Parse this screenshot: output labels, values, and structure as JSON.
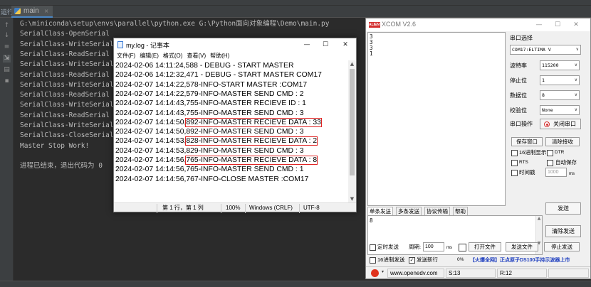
{
  "ide": {
    "run_label": "运行",
    "tab_label": "main",
    "tab_close": "×",
    "console_lines": [
      "G:\\miniconda\\setup\\envs\\parallel\\python.exe G:\\Python面向对象编程\\Demo\\main.py",
      "SerialClass-OpenSerial",
      "SerialClass-WriteSerial",
      "SerialClass-ReadSerial",
      "SerialClass-WriteSerial",
      "SerialClass-ReadSerial",
      "SerialClass-WriteSerial",
      "SerialClass-ReadSerial",
      "SerialClass-WriteSerial",
      "SerialClass-ReadSerial",
      "SerialClass-WriteSerial",
      "SerialClass-CloseSerial",
      "Master Stop Work!",
      "",
      "进程已结束，退出代码为 0"
    ]
  },
  "notepad": {
    "title": "my.log - 记事本",
    "menu": [
      "文件(F)",
      "编辑(E)",
      "格式(O)",
      "查看(V)",
      "帮助(H)"
    ],
    "lines": [
      {
        "prefix": "2024-02-06 14:11:24,588 - DEBUG - START MASTER",
        "highlight": ""
      },
      {
        "prefix": "2024-02-06 14:12:32,471 - DEBUG - START MASTER COM17",
        "highlight": ""
      },
      {
        "prefix": "2024-02-07 14:14:22,578-INFO-START MASTER :COM17",
        "highlight": ""
      },
      {
        "prefix": "2024-02-07 14:14:22,579-INFO-MASTER SEND CMD : 2",
        "highlight": ""
      },
      {
        "prefix": "2024-02-07 14:14:43,755-INFO-MASTER RECIEVE ID : 1",
        "highlight": ""
      },
      {
        "prefix": "2024-02-07 14:14:43,755-INFO-MASTER SEND CMD : 3",
        "highlight": ""
      },
      {
        "prefix": "2024-02-07 14:14:50,",
        "highlight": "892-INFO-MASTER RECIEVE DATA : 33"
      },
      {
        "prefix": "2024-02-07 14:14:50,892-INFO-MASTER SEND CMD : 3",
        "highlight": ""
      },
      {
        "prefix": "2024-02-07 14:14:53,",
        "highlight": "828-INFO-MASTER RECIEVE DATA : 2"
      },
      {
        "prefix": "2024-02-07 14:14:53,829-INFO-MASTER SEND CMD : 3",
        "highlight": ""
      },
      {
        "prefix": "2024-02-07 14:14:56,",
        "highlight": "765-INFO-MASTER RECIEVE DATA : 8"
      },
      {
        "prefix": "2024-02-07 14:14:56,765-INFO-MASTER SEND CMD : 1",
        "highlight": ""
      },
      {
        "prefix": "2024-02-07 14:14:56,767-INFO-CLOSE MASTER :COM17",
        "highlight": ""
      }
    ],
    "status": {
      "position": "第 1 行，第 1 列",
      "zoom": "100%",
      "line_ending": "Windows (CRLF)",
      "encoding": "UTF-8"
    }
  },
  "xcom": {
    "title": "XCOM V2.6",
    "logo": "ALIENTEK",
    "recv_lines": [
      "3",
      "3",
      "3",
      "1"
    ],
    "serial_select_label": "串口选择",
    "port": "COM17:ELTIMA V",
    "settings": [
      {
        "label": "波特率",
        "value": "115200"
      },
      {
        "label": "停止位",
        "value": "1"
      },
      {
        "label": "数据位",
        "value": "8"
      },
      {
        "label": "校验位",
        "value": "None"
      }
    ],
    "serial_op_label": "串口操作",
    "close_port_label": "关闭串口",
    "save_window": "保存窗口",
    "clear_recv": "清除接收",
    "hex_display": "16进制显示",
    "dtr": "DTR",
    "rts": "RTS",
    "auto_save": "自动保存",
    "timestamp": "时间戳",
    "timestamp_ms": "1000",
    "ms_unit": "ms",
    "tabs": [
      "单条发送",
      "多条发送",
      "协议传输",
      "帮助"
    ],
    "send_text": "8",
    "send_button": "发送",
    "clear_send": "清除发送",
    "timed_send": "定时发送",
    "period_label": "周期:",
    "period_value": "100",
    "open_file": "打开文件",
    "send_file": "发送文件",
    "stop_send": "停止发送",
    "hex_send": "16进制发送",
    "send_newline": "发送新行",
    "percent": "0%",
    "promo": "【火爆全网】正点原子DS100手持示波器上市",
    "status": {
      "url": "www.openedv.com",
      "s": "S:13",
      "r": "R:12"
    }
  }
}
